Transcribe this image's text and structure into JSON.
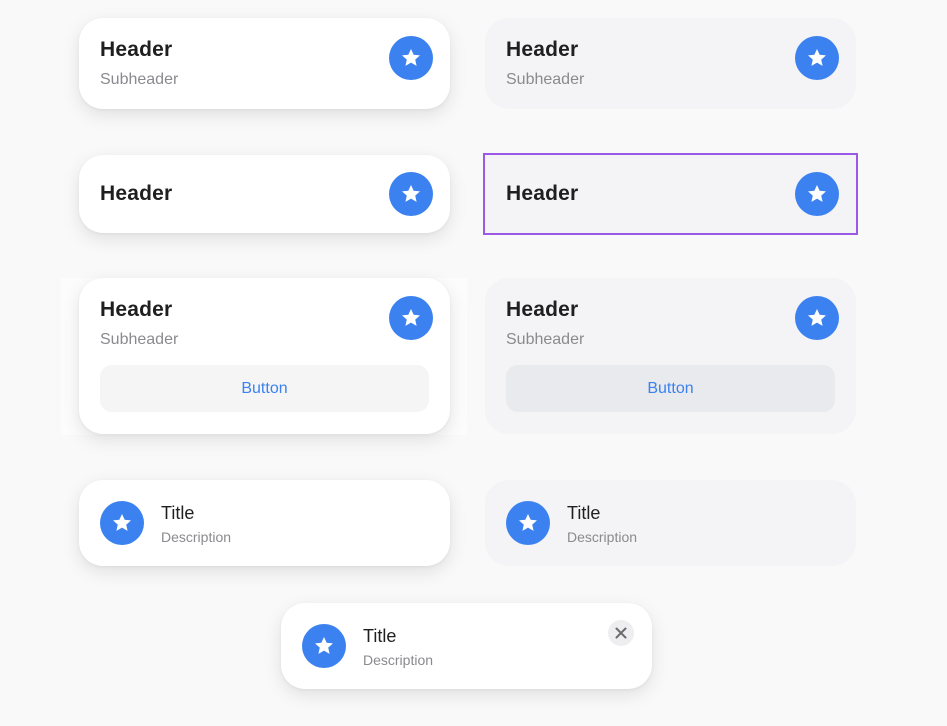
{
  "colors": {
    "accent": "#3b82f0",
    "selection_outline": "#9b59e6",
    "white_card": "#ffffff",
    "gray_card": "#f4f4f6",
    "header_text": "#1f1f1f",
    "secondary_text": "#8a8a8f"
  },
  "icons": {
    "star": "star-icon",
    "close": "close-icon"
  },
  "cards": {
    "row1_left": {
      "header": "Header",
      "subheader": "Subheader"
    },
    "row1_right": {
      "header": "Header",
      "subheader": "Subheader"
    },
    "row2_left": {
      "header": "Header"
    },
    "row2_right": {
      "header": "Header"
    },
    "row3_left": {
      "header": "Header",
      "subheader": "Subheader",
      "button": "Button"
    },
    "row3_right": {
      "header": "Header",
      "subheader": "Subheader",
      "button": "Button"
    },
    "row4_left": {
      "title": "Title",
      "description": "Description"
    },
    "row4_right": {
      "title": "Title",
      "description": "Description"
    },
    "toast": {
      "title": "Title",
      "description": "Description"
    }
  }
}
